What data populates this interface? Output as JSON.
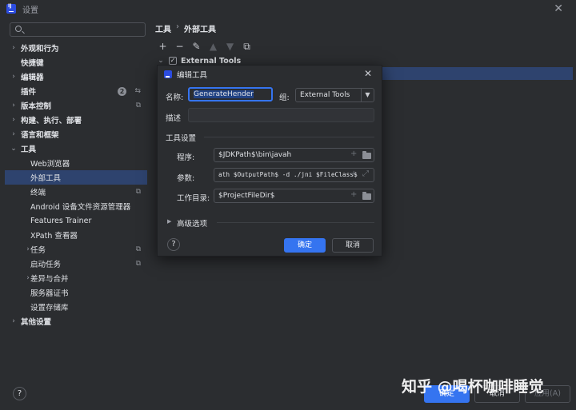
{
  "window": {
    "title": "设置"
  },
  "search": {
    "placeholder": ""
  },
  "sidebar": {
    "items": [
      {
        "label": "外观和行为",
        "expandable": true,
        "bold": true
      },
      {
        "label": "快捷键",
        "expandable": false,
        "bold": true
      },
      {
        "label": "编辑器",
        "expandable": true,
        "bold": true
      },
      {
        "label": "插件",
        "expandable": false,
        "bold": true,
        "badge": "2"
      },
      {
        "label": "版本控制",
        "expandable": true,
        "bold": true
      },
      {
        "label": "构建、执行、部署",
        "expandable": true,
        "bold": true
      },
      {
        "label": "语言和框架",
        "expandable": true,
        "bold": true
      },
      {
        "label": "工具",
        "expandable": true,
        "expanded": true,
        "bold": true
      },
      {
        "label": "Web浏览器",
        "indent": 1
      },
      {
        "label": "外部工具",
        "indent": 1,
        "selected": true
      },
      {
        "label": "终端",
        "indent": 1
      },
      {
        "label": "Android 设备文件资源管理器",
        "indent": 1
      },
      {
        "label": "Features Trainer",
        "indent": 1
      },
      {
        "label": "XPath 查看器",
        "indent": 1
      },
      {
        "label": "任务",
        "indent": 1,
        "expandable": true
      },
      {
        "label": "启动任务",
        "indent": 1
      },
      {
        "label": "差异与合并",
        "indent": 1,
        "expandable": true
      },
      {
        "label": "服务器证书",
        "indent": 1
      },
      {
        "label": "设置存储库",
        "indent": 1
      },
      {
        "label": "其他设置",
        "expandable": true,
        "bold": true
      }
    ]
  },
  "breadcrumb": {
    "parent": "工具",
    "sep": "›",
    "current": "外部工具"
  },
  "tools_tree": {
    "group": "External Tools"
  },
  "footer": {
    "help": "?",
    "ok": "确定",
    "cancel": "取消",
    "apply": "应用(A)"
  },
  "dialog": {
    "title": "编辑工具",
    "name_label": "名称:",
    "name_value": "GenerateHender",
    "group_label": "组:",
    "group_value": "External Tools",
    "desc_label": "描述",
    "desc_value": "",
    "section_tool_settings": "工具设置",
    "program_label": "程序:",
    "program_value": "$JDKPath$\\bin\\javah",
    "args_label": "参数:",
    "args_value": "ath $OutputPath$ -d ./jni $FileClass$",
    "workdir_label": "工作目录:",
    "workdir_value": "$ProjectFileDir$",
    "advanced_label": "高级选项",
    "help": "?",
    "ok": "确定",
    "cancel": "取消"
  },
  "watermark": "知乎 @喝杯咖啡睡觉",
  "colors": {
    "accent": "#3574f0",
    "selection": "#2e436e",
    "bg": "#2b2d30"
  }
}
